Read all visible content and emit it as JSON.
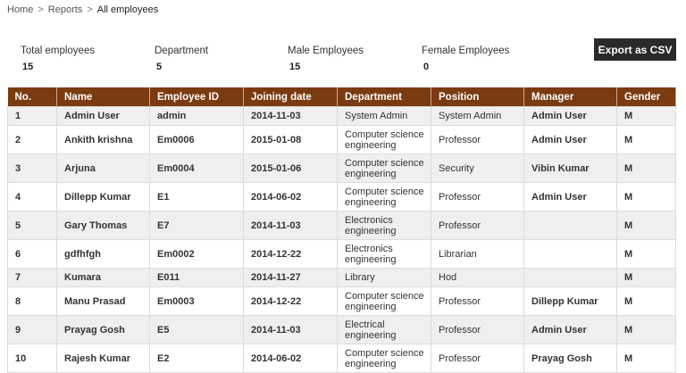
{
  "breadcrumb": {
    "home": "Home",
    "reports": "Reports",
    "current": "All employees",
    "separator": ">"
  },
  "stats": [
    {
      "label": "Total employees",
      "value": "15"
    },
    {
      "label": "Department",
      "value": "5"
    },
    {
      "label": "Male Employees",
      "value": "15"
    },
    {
      "label": "Female Employees",
      "value": "0"
    }
  ],
  "export_label": "Export as CSV",
  "colors": {
    "header_bg": "#7a3b10",
    "button_bg": "#2a2a2a"
  },
  "table": {
    "headers": [
      "No.",
      "Name",
      "Employee ID",
      "Joining date",
      "Department",
      "Position",
      "Manager",
      "Gender"
    ],
    "rows": [
      [
        "1",
        "Admin User",
        "admin",
        "2014-11-03",
        "System Admin",
        "System Admin",
        "Admin User",
        "M"
      ],
      [
        "2",
        "Ankith krishna",
        "Em0006",
        "2015-01-08",
        "Computer science engineering",
        "Professor",
        "Admin User",
        "M"
      ],
      [
        "3",
        "Arjuna",
        "Em0004",
        "2015-01-06",
        "Computer science engineering",
        "Security",
        "Vibin Kumar",
        "M"
      ],
      [
        "4",
        "Dillepp Kumar",
        "E1",
        "2014-06-02",
        "Computer science engineering",
        "Professor",
        "Admin User",
        "M"
      ],
      [
        "5",
        "Gary Thomas",
        "E7",
        "2014-11-03",
        "Electronics engineering",
        "Professor",
        "",
        "M"
      ],
      [
        "6",
        "gdfhfgh",
        "Em0002",
        "2014-12-22",
        "Electronics engineering",
        "Librarian",
        "",
        "M"
      ],
      [
        "7",
        "Kumara",
        "E011",
        "2014-11-27",
        "Library",
        "Hod",
        "",
        "M"
      ],
      [
        "8",
        "Manu Prasad",
        "Em0003",
        "2014-12-22",
        "Computer science engineering",
        "Professor",
        "Dillepp Kumar",
        "M"
      ],
      [
        "9",
        "Prayag Gosh",
        "E5",
        "2014-11-03",
        "Electrical engineering",
        "Professor",
        "Admin User",
        "M"
      ],
      [
        "10",
        "Rajesh Kumar",
        "E2",
        "2014-06-02",
        "Computer science engineering",
        "Professor",
        "Prayag Gosh",
        "M"
      ]
    ]
  }
}
